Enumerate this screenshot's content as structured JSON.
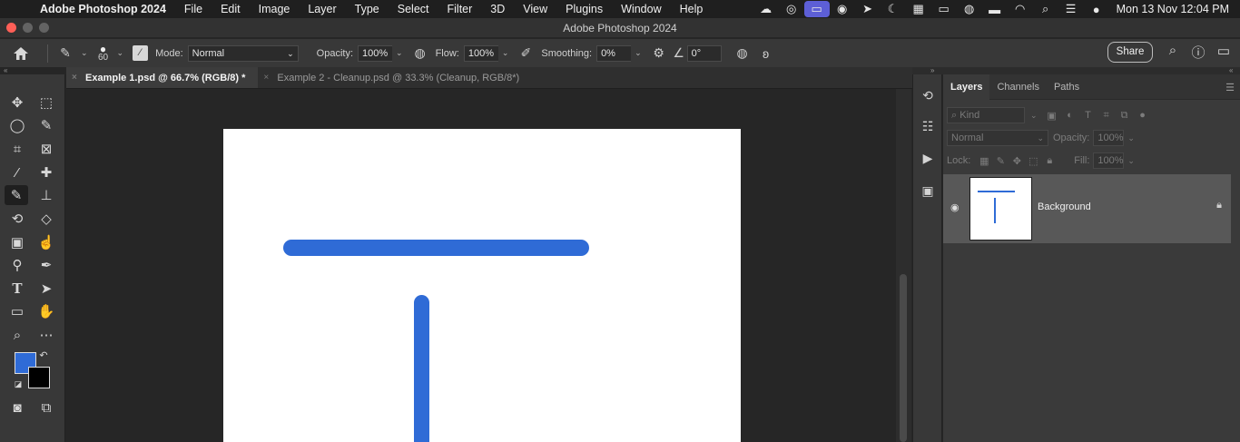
{
  "menubar": {
    "apple": "",
    "app_name": "Adobe Photoshop 2024",
    "items": [
      "File",
      "Edit",
      "Image",
      "Layer",
      "Type",
      "Select",
      "Filter",
      "3D",
      "View",
      "Plugins",
      "Window",
      "Help"
    ],
    "clock": "Mon 13 Nov  12:04 PM"
  },
  "window": {
    "title": "Adobe Photoshop 2024",
    "traffic_colors": [
      "#ff5f57",
      "#febc2e",
      "#28c840"
    ]
  },
  "options": {
    "brush_size": "60",
    "mode_label": "Mode:",
    "mode_value": "Normal",
    "opacity_label": "Opacity:",
    "opacity_value": "100%",
    "flow_label": "Flow:",
    "flow_value": "100%",
    "smoothing_label": "Smoothing:",
    "smoothing_value": "0%",
    "angle_value": "0°",
    "share_label": "Share"
  },
  "tabs": [
    {
      "label": "Example 1.psd @ 66.7% (RGB/8) *",
      "active": true
    },
    {
      "label": "Example 2 - Cleanup.psd @ 33.3% (Cleanup, RGB/8*)",
      "active": false
    }
  ],
  "colors": {
    "foreground": "#2f6bd6",
    "background": "#000000",
    "stroke": "#2f6bd6",
    "accent": "#5d5fd6"
  },
  "layers_panel": {
    "tabs": [
      "Layers",
      "Channels",
      "Paths"
    ],
    "kind_placeholder": "Kind",
    "blend_mode": "Normal",
    "opacity_label": "Opacity:",
    "opacity_value": "100%",
    "lock_label": "Lock:",
    "fill_label": "Fill:",
    "fill_value": "100%",
    "layers": [
      {
        "name": "Background",
        "visible": true,
        "locked": true
      }
    ]
  },
  "icons": {
    "tools": [
      "move-icon",
      "marquee-icon",
      "lasso-icon",
      "quick-select-icon",
      "crop-icon",
      "frame-icon",
      "eyedropper-icon",
      "healing-icon",
      "brush-icon",
      "stamp-icon",
      "history-brush-icon",
      "eraser-icon",
      "gradient-icon",
      "smudge-icon",
      "dodge-icon",
      "pen-icon",
      "type-icon",
      "path-select-icon",
      "rectangle-icon",
      "hand-icon",
      "zoom-icon",
      "more-icon"
    ]
  }
}
